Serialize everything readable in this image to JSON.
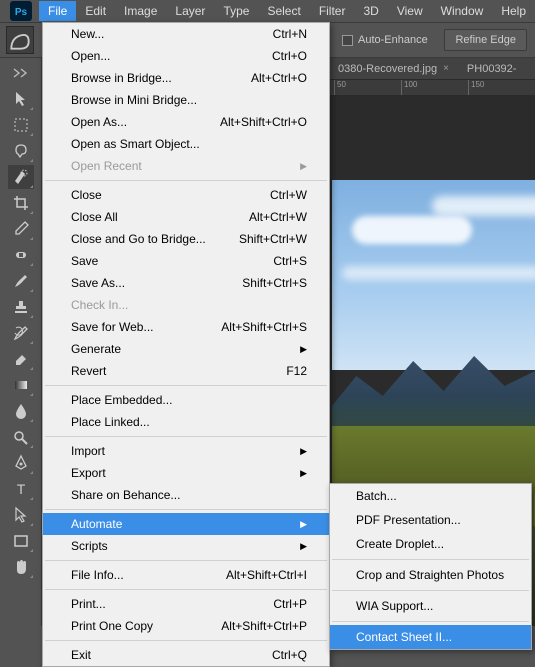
{
  "menubar": {
    "items": [
      "File",
      "Edit",
      "Image",
      "Layer",
      "Type",
      "Select",
      "Filter",
      "3D",
      "View",
      "Window",
      "Help"
    ]
  },
  "optionsbar": {
    "auto_enhance": "Auto-Enhance",
    "refine": "Refine Edge"
  },
  "tabs": {
    "t0": "0380-Recovered.jpg",
    "t1": "PH00392-"
  },
  "ruler": {
    "t0": "50",
    "t1": "100",
    "t2": "150"
  },
  "file_menu": {
    "new": "New...",
    "new_k": "Ctrl+N",
    "open": "Open...",
    "open_k": "Ctrl+O",
    "browse": "Browse in Bridge...",
    "browse_k": "Alt+Ctrl+O",
    "minibridge": "Browse in Mini Bridge...",
    "openas": "Open As...",
    "openas_k": "Alt+Shift+Ctrl+O",
    "smart": "Open as Smart Object...",
    "recent": "Open Recent",
    "close": "Close",
    "close_k": "Ctrl+W",
    "closeall": "Close All",
    "closeall_k": "Alt+Ctrl+W",
    "closebridge": "Close and Go to Bridge...",
    "closebridge_k": "Shift+Ctrl+W",
    "save": "Save",
    "save_k": "Ctrl+S",
    "saveas": "Save As...",
    "saveas_k": "Shift+Ctrl+S",
    "checkin": "Check In...",
    "saveweb": "Save for Web...",
    "saveweb_k": "Alt+Shift+Ctrl+S",
    "generate": "Generate",
    "revert": "Revert",
    "revert_k": "F12",
    "place_embed": "Place Embedded...",
    "place_link": "Place Linked...",
    "import": "Import",
    "export": "Export",
    "behance": "Share on Behance...",
    "automate": "Automate",
    "scripts": "Scripts",
    "fileinfo": "File Info...",
    "fileinfo_k": "Alt+Shift+Ctrl+I",
    "print": "Print...",
    "print_k": "Ctrl+P",
    "print1": "Print One Copy",
    "print1_k": "Alt+Shift+Ctrl+P",
    "exit": "Exit",
    "exit_k": "Ctrl+Q"
  },
  "automate_submenu": {
    "batch": "Batch...",
    "pdf": "PDF Presentation...",
    "droplet": "Create Droplet...",
    "crop": "Crop and Straighten Photos",
    "wia": "WIA Support...",
    "contact": "Contact Sheet II..."
  }
}
